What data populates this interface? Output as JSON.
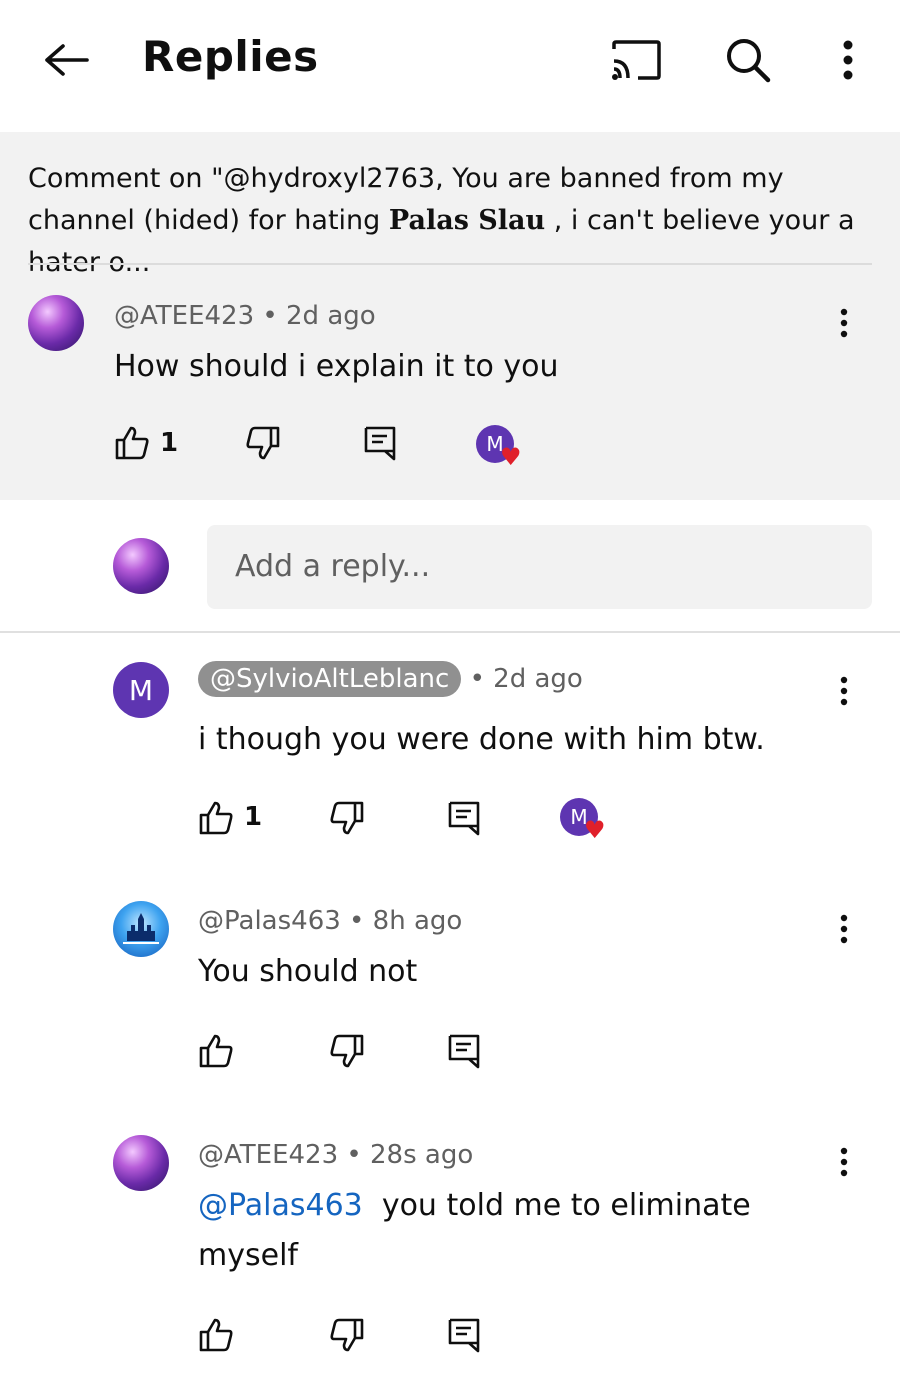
{
  "header": {
    "title": "Replies"
  },
  "context": {
    "text_before": "Comment on \"@hydroxyl2763, You are banned from my channel (hided) for hating ",
    "bold": "Palas Slau",
    "text_after": " , i can't believe your a hater o..."
  },
  "parent_comment": {
    "handle": "@ATEE423",
    "age": "2d ago",
    "text": "How should i explain it to you",
    "likes": "1"
  },
  "reply_box": {
    "placeholder": "Add a reply..."
  },
  "replies": [
    {
      "avatar_letter": "M",
      "handle": "@SylvioAltLeblanc",
      "age": "2d ago",
      "text": "i though you were done with him btw.",
      "likes": "1"
    },
    {
      "handle": "@Palas463",
      "age": "8h ago",
      "text": "You should not"
    },
    {
      "handle": "@ATEE423",
      "age": "28s ago",
      "mention": "@Palas463",
      "text_line1": "you told me to eliminate",
      "text_line2": "myself"
    }
  ],
  "heart_badge": {
    "letter": "M",
    "heart": "♥"
  },
  "separator": "•",
  "icons": [
    "back-arrow-icon",
    "cast-icon",
    "search-icon",
    "more-vert-icon",
    "thumbs-up-icon",
    "thumbs-down-icon",
    "reply-comment-icon",
    "creator-heart-icon"
  ],
  "colors": {
    "context_bg": "#f2f2f2",
    "avatar_purple": "#5e35b1",
    "heart_red": "#e0202a",
    "mention_blue": "#1565c0",
    "handle_pill": "#909090"
  }
}
